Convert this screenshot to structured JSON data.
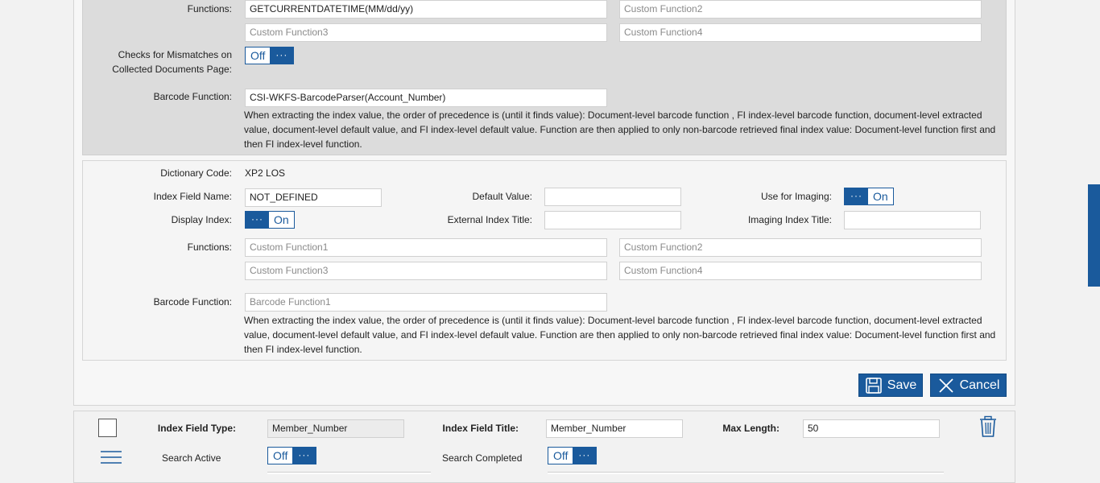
{
  "top_section": {
    "functions_label": "Functions:",
    "function1_value": "GETCURRENTDATETIME(MM/dd/yy)",
    "function2_placeholder": "Custom Function2",
    "function3_placeholder": "Custom Function3",
    "function4_placeholder": "Custom Function4",
    "mismatch_label_line1": "Checks for Mismatches on",
    "mismatch_label_line2": "Collected Documents Page:",
    "mismatch_toggle": {
      "state": "Off",
      "dots": "···"
    },
    "barcode_label": "Barcode Function:",
    "barcode_value": "CSI-WKFS-BarcodeParser(Account_Number)",
    "help_text": "When extracting the index value, the order of precedence is (until it finds value): Document-level barcode function , FI index-level barcode function, document-level extracted value, document-level default value, and FI index-level default value. Function are then applied to only non-barcode retrieved final index value: Document-level function first and then FI index-level function."
  },
  "detail_section": {
    "dictionary_code_label": "Dictionary Code:",
    "dictionary_code_value": "XP2 LOS",
    "index_field_name_label": "Index Field Name:",
    "index_field_name_value": "NOT_DEFINED",
    "default_value_label": "Default Value:",
    "default_value_value": "",
    "use_for_imaging_label": "Use for Imaging:",
    "use_for_imaging_toggle": {
      "state": "On",
      "dots": "···"
    },
    "display_index_label": "Display Index:",
    "display_index_toggle": {
      "state": "On",
      "dots": "···"
    },
    "external_index_title_label": "External Index Title:",
    "external_index_title_value": "",
    "imaging_index_title_label": "Imaging Index Title:",
    "imaging_index_title_value": "",
    "functions_label": "Functions:",
    "function1_placeholder": "Custom Function1",
    "function2_placeholder": "Custom Function2",
    "function3_placeholder": "Custom Function3",
    "function4_placeholder": "Custom Function4",
    "barcode_label": "Barcode Function:",
    "barcode_placeholder": "Barcode Function1",
    "help_text": "When extracting the index value, the order of precedence is (until it finds value): Document-level barcode function , FI index-level barcode function, document-level extracted value, document-level default value, and FI index-level default value. Function are then applied to only non-barcode retrieved final index value: Document-level function first and then FI index-level function."
  },
  "actions": {
    "save_label": "Save",
    "cancel_label": "Cancel"
  },
  "index_row": {
    "index_field_type_label": "Index Field Type:",
    "index_field_type_value": "Member_Number",
    "index_field_title_label": "Index Field Title:",
    "index_field_title_value": "Member_Number",
    "max_length_label": "Max Length:",
    "max_length_value": "50",
    "search_active_label": "Search Active",
    "search_active_toggle": {
      "state": "Off",
      "dots": "···"
    },
    "search_completed_label": "Search Completed",
    "search_completed_toggle": {
      "state": "Off",
      "dots": "···"
    }
  },
  "colors": {
    "accent": "#1a5a9c",
    "grey_panel": "#dcdcdc",
    "background": "#f2f2f2"
  }
}
